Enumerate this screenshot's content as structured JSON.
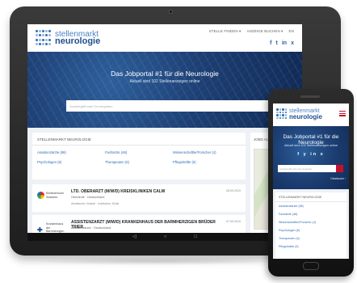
{
  "brand": {
    "line1": "stellenmarkt",
    "line2": "neurologie",
    "accent": "#2d6db5",
    "red": "#c8102e"
  },
  "nav": [
    {
      "label": "STELLE FINDEN ▾"
    },
    {
      "label": "ANZEIGE BUCHEN ▾"
    },
    {
      "label": "EN"
    }
  ],
  "social": {
    "icons": [
      "f",
      "t",
      "in",
      "x"
    ]
  },
  "hero": {
    "title": "Das Jobportal #1 für die Neurologie",
    "subtitle": "Aktuell sind 102 Stellenanzeigen online",
    "search_placeholder": "Suchbegriff oder Ort eingeben"
  },
  "panel": {
    "title": "STELLENMARKT NEUROLOGIE",
    "categories": [
      "Assistenzärzte (98)",
      "Fachärzte (48)",
      "Wissenschaftler/Forscher (4)",
      "Psychologen (6)",
      "Therapeuten (6)",
      "Pflegekräfte (5)"
    ]
  },
  "side": {
    "title": "JOBS AUF"
  },
  "jobs": [
    {
      "logo": "Klinikverbund Südwest",
      "title": "LTD. OBERARZT (M/W/D) KREISKLINIKEN CALW",
      "location": "Oberärzte · Deutschland",
      "meta": "Arbeitszeit: Vollzeit · Institution: Klinik",
      "date": "08.09.2019"
    },
    {
      "logo": "Krankenhaus der Barmherzigen Brüder Trier",
      "title": "ASSISTENZARZT (M/W/D) KRANKENHAUS DER BARMHERZIGEN BRÜDER TRIER",
      "location": "Assistenzärzte · Deutschland",
      "meta": "Arbeitszeit: Vollzeit · Institution: Klinik",
      "date": "07.09.2019"
    }
  ],
  "phone": {
    "hero_title": "Das Jobportal #1 für die Neurologie",
    "hero_subtitle": "Aktuell sind 102 Stellenanzeigen online",
    "social": "f y in x",
    "search_placeholder": "Suchbegriff oder Ort eingeben",
    "detail_link": "Detailsuche ›",
    "panel_title": "STELLENMARKT NEUROLOGIE",
    "categories": [
      "Assistenzärzte (98)",
      "Fachärzte (48)",
      "Wissenschaftler/Forscher (4)",
      "Psychologen (6)",
      "Therapeuten (6)",
      "Pflegekräfte (5)"
    ]
  },
  "softkeys": [
    "◁",
    "○",
    "□"
  ]
}
